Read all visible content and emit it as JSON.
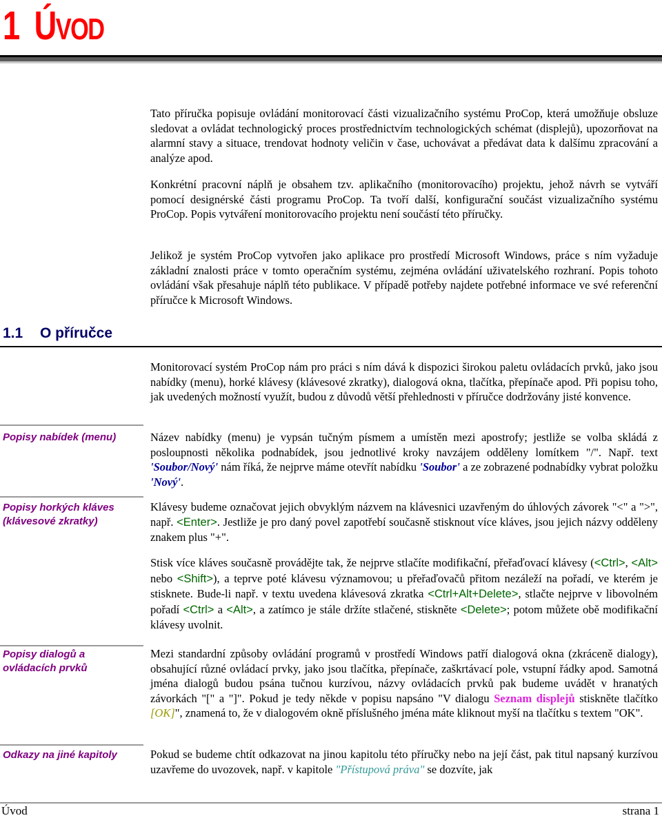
{
  "chapter": {
    "number": "1",
    "title_first": "Ú",
    "title_rest": "VOD"
  },
  "intro": [
    "Tato příručka popisuje ovládání monitorovací části vizualizačního systému ProCop, která umožňuje obsluze sledovat a ovládat technologický proces prostřednictvím technologických schémat (displejů), upozorňovat na alarmní stavy a situace, trendovat hodnoty veličin v čase, uchovávat a předávat data k dalšímu zpracování a analýze apod.",
    "Konkrétní pracovní náplň je obsahem tzv. aplikačního (monitorovacího) projektu, jehož návrh se vytváří pomocí designérské části programu ProCop. Ta tvoří další, konfigurační součást vizualizačního systému ProCop. Popis vytváření monitorovacího projektu není součástí této příručky.",
    "Jelikož je systém ProCop vytvořen jako aplikace pro prostředí Microsoft Windows, práce s ním vyžaduje základní znalosti práce v tomto operačním systému, zejména ovládání uživatelského rozhraní. Popis tohoto ovládání však přesahuje náplň této publikace. V případě potřeby najdete potřebné informace ve své referenční příručce k Microsoft Windows."
  ],
  "section": {
    "number": "1.1",
    "title": "O příručce",
    "intro": "Monitorovací systém ProCop nám pro práci s ním dává k dispozici širokou paletu ovládacích prvků, jako jsou nabídky (menu), horké klávesy (klávesové zkratky), dialogová okna, tlačítka, přepínače apod. Při popisu toho, jak uvedených možností využít, budou z důvodů větší přehlednosti v příručce dodržovány jisté konvence."
  },
  "conventions": {
    "menus": {
      "label": "Popisy nabídek (menu)",
      "t1": "Název nabídky (menu) je vypsán tučným písmem a umístěn mezi apostrofy; jestliže se volba skládá z posloupnosti několika podnabídek, jsou jednotlivé kroky navzájem odděleny lomítkem \"/\". Např. text ",
      "r1": "'Soubor/Nový'",
      "t2": " nám říká, že nejprve máme otevřít nabídku ",
      "r2": "'Soubor'",
      "t3": " a ze zobrazené podnabídky vybrat položku ",
      "r3": "'Nový'",
      "t4": "."
    },
    "hotkeys": {
      "label": "Popisy horkých kláves (klávesové zkratky)",
      "t1": "Klávesy budeme označovat jejich obvyklým názvem na klávesnici uzavřeným do úhlových závorek \"<\" a \">\", např. ",
      "k1": "<Enter>",
      "t2": ". Jestliže je pro daný povel zapotřebí současně stisknout více kláves, jsou jejich názvy odděleny znakem plus \"+\"."
    },
    "hotkeys2": {
      "t1": "Stisk více kláves současně provádějte tak, že nejprve stlačíte modifikační, přeřaďovací klávesy (",
      "k1": "<Ctrl>",
      "t2": ", ",
      "k2": "<Alt>",
      "t3": " nebo ",
      "k3": "<Shift>",
      "t4": "), a teprve poté klávesu významovou; u přeřaďovačů přitom nezáleží na pořadí, ve kterém je stisknete. Bude-li např. v textu uvedena klávesová zkratka ",
      "k4": "<Ctrl+Alt+Delete>",
      "t5": ", stlačte nejprve v libovolném pořadí ",
      "k5": "<Ctrl>",
      "t6": " a ",
      "k6": "<Alt>",
      "t7": ", a zatímco je stále držíte stlačené, stiskněte ",
      "k7": "<Delete>",
      "t8": "; potom můžete obě modifikační klávesy uvolnit."
    },
    "dialogs": {
      "label": "Popisy dialogů a ovládacích prvků",
      "t1": "Mezi standardní způsoby ovládání programů v prostředí Windows patří dialogová okna (zkráceně dialogy), obsahující různé ovládací prvky, jako jsou tlačítka, přepínače, zaškrtávací pole, vstupní řádky apod. Samotná jména dialogů budou psána tučnou kurzívou, názvy ovládacích prvků pak budeme uvádět v hranatých závorkách \"[\" a \"]\". Pokud je tedy někde v popisu napsáno \"V dialogu ",
      "d1": "Seznam displejů",
      "t2": " stiskněte tlačítko ",
      "c1": "[OK]",
      "t3": "\", znamená to, že v dialogovém okně příslušného jména máte kliknout myší na tlačítku s textem \"OK\"."
    },
    "references": {
      "label": "Odkazy na jiné kapitoly",
      "t1": "Pokud se budeme chtít odkazovat na jinou kapitolu této příručky nebo na její část, pak titul napsaný kurzívou uzavřeme do uvozovek, např. v kapitole ",
      "r1": "\"Přístupová práva\"",
      "t2": " se dozvíte, jak"
    }
  },
  "footer": {
    "left": "Úvod",
    "right": "strana 1"
  }
}
